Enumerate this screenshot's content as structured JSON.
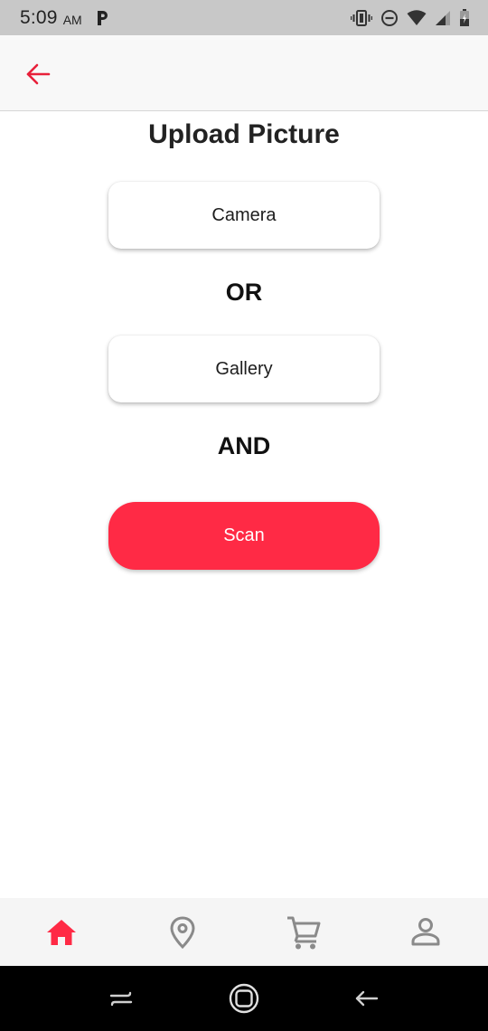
{
  "status_bar": {
    "time": "5:09",
    "ampm": "AM",
    "icons": [
      "p-app-icon",
      "vibrate-icon",
      "do-not-disturb-icon",
      "wifi-icon",
      "signal-icon",
      "battery-icon"
    ]
  },
  "app_bar": {
    "back_icon": "arrow-left-icon",
    "accent_color": "#e8203a"
  },
  "main": {
    "title": "Upload Picture",
    "camera_label": "Camera",
    "or_label": "OR",
    "gallery_label": "Gallery",
    "and_label": "AND",
    "scan_label": "Scan",
    "scan_color": "#ff2a45"
  },
  "bottom_nav": {
    "items": [
      {
        "icon": "home-icon",
        "active": true
      },
      {
        "icon": "location-pin-icon",
        "active": false
      },
      {
        "icon": "cart-icon",
        "active": false
      },
      {
        "icon": "profile-icon",
        "active": false
      }
    ],
    "active_color": "#ff2a45",
    "inactive_color": "#8a8a8a"
  },
  "system_nav": {
    "icons": [
      "recents-icon",
      "home-circle-icon",
      "back-arrow-icon"
    ]
  }
}
